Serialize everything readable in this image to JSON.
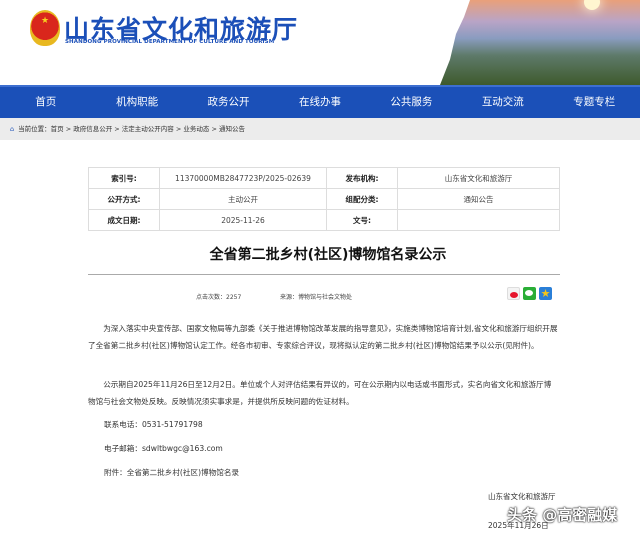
{
  "header": {
    "title": "山东省文化和旅游厅",
    "subtitle": "SHANDONG PROVINCIAL DEPARTMENT OF CULTURE AND  TOURISM"
  },
  "nav": [
    "首页",
    "机构职能",
    "政务公开",
    "在线办事",
    "公共服务",
    "互动交流",
    "专题专栏"
  ],
  "breadcrumb": {
    "label": "当前位置：",
    "path": "首页 > 政府信息公开 > 法定主动公开内容 > 业务动态 > 通知公告"
  },
  "info": {
    "index_label": "索引号:",
    "index": "11370000MB2847723P/2025-02639",
    "publisher_label": "发布机构:",
    "publisher": "山东省文化和旅游厅",
    "mode_label": "公开方式:",
    "mode": "主动公开",
    "category_label": "组配分类:",
    "category": "通知公告",
    "date_label": "成文日期:",
    "date": "2025-11-26",
    "docno_label": "文号:",
    "docno": ""
  },
  "article": {
    "title": "全省第二批乡村(社区)博物馆名录公示",
    "clicks_label": "点击次数：",
    "clicks": "2257",
    "source_label": "来源：",
    "source": "博物馆与社会文物处",
    "p1": "为深入落实中央宣传部、国家文物局等九部委《关于推进博物馆改革发展的指导意见》，实施类博物馆培育计划,省文化和旅游厅组织开展了全省第二批乡村(社区)博物馆认定工作。经各市初审、专家综合评议，现将拟认定的第二批乡村(社区)博物馆结果予以公示(见附件)。",
    "p2": "公示期自2025年11月26日至12月2日。单位或个人对评估结果有异议的，可在公示期内以电话或书面形式，实名向省文化和旅游厅博物馆与社会文物处反映。反映情况须实事求是，并提供所反映问题的佐证材料。",
    "phone": "联系电话：0531-51791798",
    "email": "电子邮箱：sdwltbwgc@163.com",
    "attachment": "附件：全省第二批乡村(社区)博物馆名录",
    "signature": "山东省文化和旅游厅",
    "sign_date": "2025年11月26日"
  },
  "watermark": "头条 @高密融媒"
}
